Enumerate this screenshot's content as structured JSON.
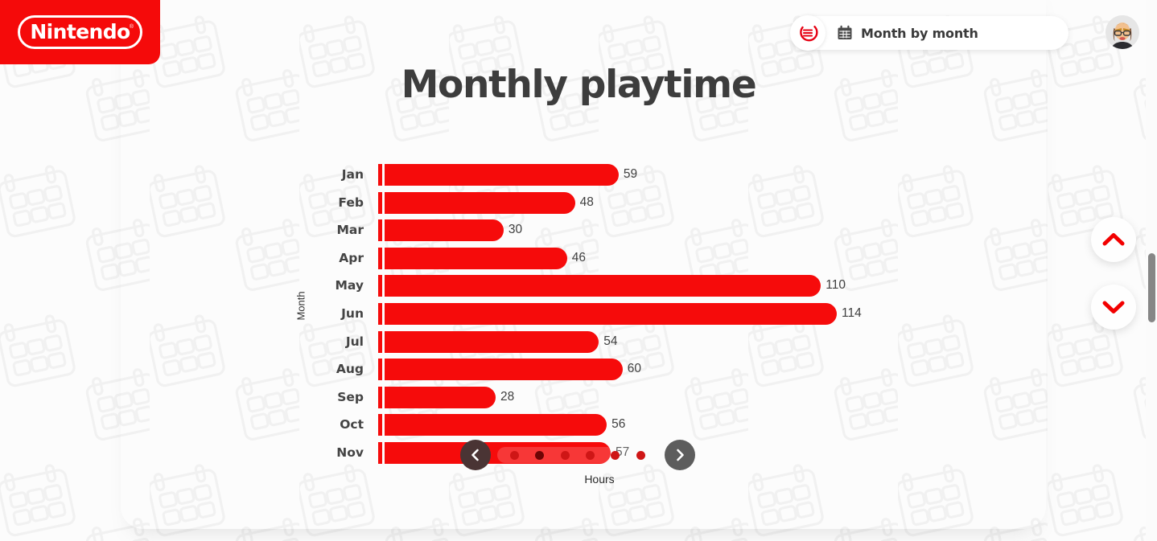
{
  "brand": {
    "logo_text": "Nintendo",
    "logo_trademark": "®",
    "logo_color": "#f50a0a"
  },
  "header": {
    "menu_icon": "hamburger-menu-icon",
    "calendar_icon": "calendar-icon",
    "view_label": "Month by month",
    "avatar_label": "user-avatar"
  },
  "page": {
    "title": "Monthly playtime"
  },
  "carousel": {
    "prev_label": "‹",
    "next_label": "›",
    "dot_count": 6,
    "active_dot_index": 1
  },
  "scroll_nav": {
    "up_label": "scroll-up",
    "down_label": "scroll-down"
  },
  "chart_data": {
    "type": "bar",
    "orientation": "horizontal",
    "title": "Monthly playtime",
    "xlabel": "Hours",
    "ylabel": "Month",
    "categories": [
      "Jan",
      "Feb",
      "Mar",
      "Apr",
      "May",
      "Jun",
      "Jul",
      "Aug",
      "Sep",
      "Oct",
      "Nov"
    ],
    "values": [
      59,
      48,
      30,
      46,
      110,
      114,
      54,
      60,
      28,
      56,
      57
    ],
    "value_labels": [
      "59",
      "48",
      "30",
      "46",
      "110",
      "114",
      "54",
      "60",
      "28",
      "56",
      "57"
    ],
    "xlim": [
      0,
      120
    ],
    "grid": false,
    "legend": null,
    "bar_color": "#f60b0b",
    "note": "Nov bar is partially overlapped by the carousel control"
  }
}
